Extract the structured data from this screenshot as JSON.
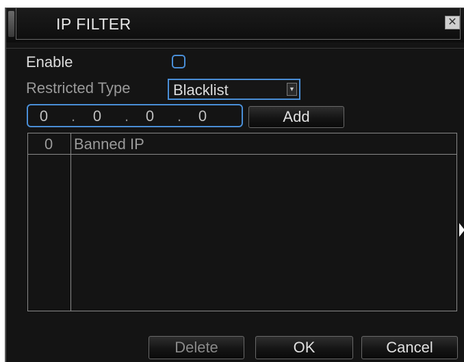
{
  "window": {
    "title": "IP FILTER",
    "close_symbol": "✕"
  },
  "form": {
    "enable_label": "Enable",
    "enable_checked": false,
    "restricted_type_label": "Restricted Type",
    "restricted_type_value": "Blacklist",
    "ip_segments": [
      "0",
      "0",
      "0",
      "0"
    ],
    "ip_separator": ".",
    "add_label": "Add"
  },
  "table": {
    "headers": [
      "0",
      "Banned IP"
    ],
    "rows": []
  },
  "footer": {
    "delete_label": "Delete",
    "ok_label": "OK",
    "cancel_label": "Cancel"
  },
  "colors": {
    "accent": "#4a8fd8",
    "background": "#141414"
  }
}
